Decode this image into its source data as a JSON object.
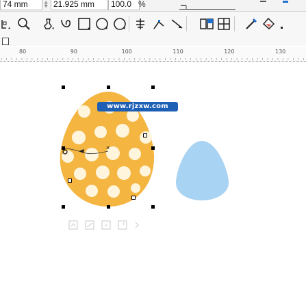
{
  "property_bar": {
    "width_value": "74 mm",
    "y_position_value": "21.925 mm",
    "scale_value": "100.0",
    "scale_unit": "%"
  },
  "toolbar": {
    "tools": [
      "node-edit-icon",
      "zoom-icon",
      "freehand-icon",
      "smart-fill-icon",
      "rectangle-icon",
      "ellipse-icon",
      "polygon-icon",
      "text-icon",
      "connector-icon",
      "dimension-icon",
      "interactive-icon",
      "table-icon",
      "eyedropper-icon",
      "fill-icon"
    ]
  },
  "ruler": {
    "labels": [
      "80",
      "90",
      "100",
      "110",
      "120",
      "130"
    ]
  },
  "watermark": {
    "text": "www.rjzxw.com"
  },
  "colors": {
    "orange_egg": "#f4b541",
    "polka_dot": "#fef5dc",
    "blue_egg": "#a9d3f2",
    "accent_blue": "#1d6fd0"
  }
}
